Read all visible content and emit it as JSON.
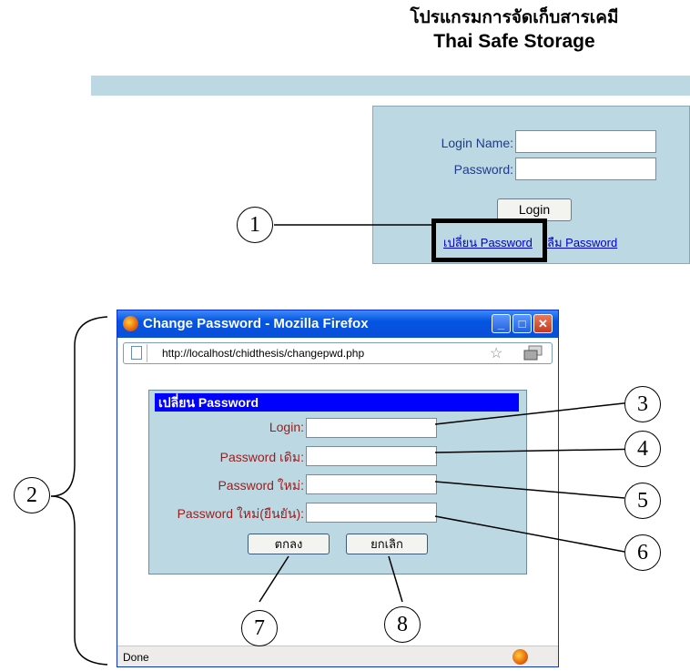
{
  "header": {
    "title_thai": "โปรแกรมการจัดเก็บสารเคมี",
    "title_en": "Thai Safe Storage"
  },
  "login_panel": {
    "login_name_label": "Login Name:",
    "password_label": "Password:",
    "login_name_value": "",
    "password_value": "",
    "login_button": "Login",
    "change_password_link": "เปลี่ยน Password",
    "forgot_password_link": "ลืม Password"
  },
  "browser": {
    "window_title": "Change Password - Mozilla Firefox",
    "url": "http://localhost/chidthesis/changepwd.php",
    "status": "Done",
    "window_buttons": [
      "_",
      "□",
      "✕"
    ]
  },
  "change_password_form": {
    "header": "เปลี่ยน Password",
    "fields": [
      {
        "label": "Login:",
        "value": ""
      },
      {
        "label": "Password เดิม:",
        "value": ""
      },
      {
        "label": "Password ใหม่:",
        "value": ""
      },
      {
        "label": "Password ใหม่(ยืนยัน):",
        "value": ""
      }
    ],
    "ok_button": "ตกลง",
    "cancel_button": "ยกเลิก"
  },
  "callouts": [
    "1",
    "2",
    "3",
    "4",
    "5",
    "6",
    "7",
    "8"
  ],
  "colors": {
    "banner": "#bcd9e3",
    "form_header": "#0000ff",
    "form_label": "#9b1c1c",
    "titlebar": "#0454e3"
  },
  "icons": [
    "firefox-logo-icon",
    "page-icon",
    "bookmark-star-icon",
    "minimize-icon",
    "maximize-icon",
    "close-icon"
  ]
}
